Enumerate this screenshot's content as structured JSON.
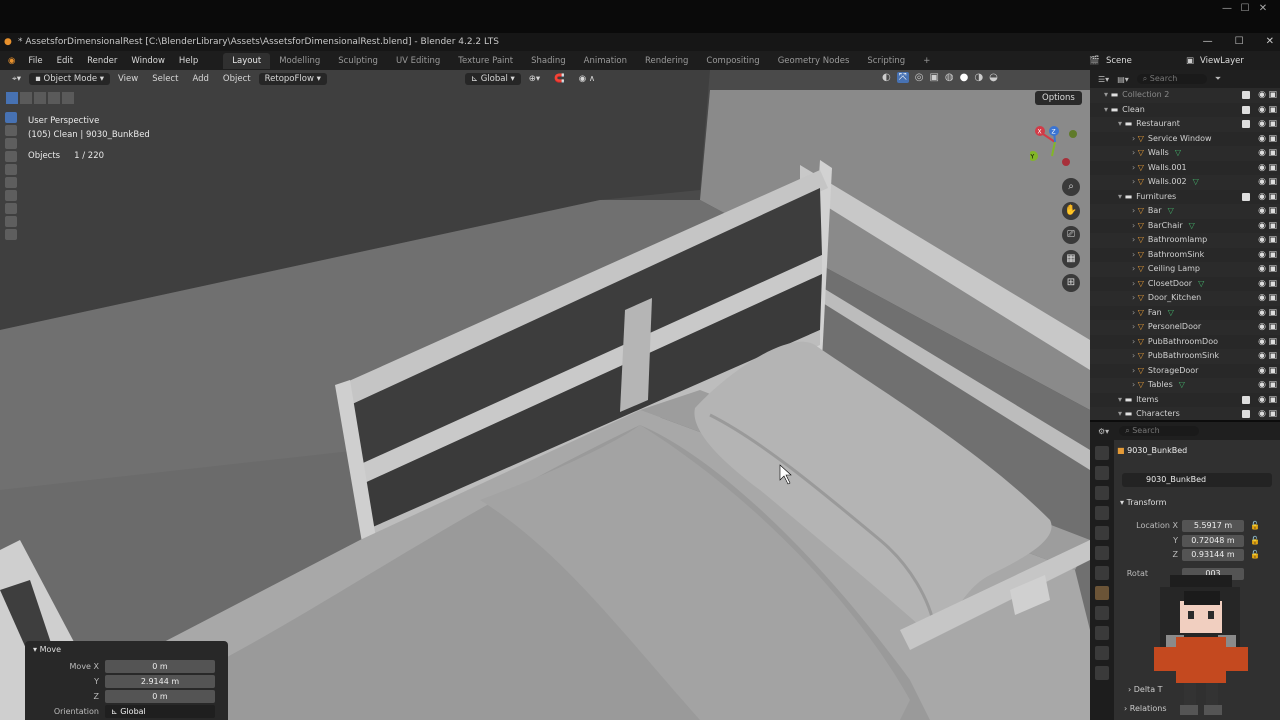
{
  "window": {
    "title": "* AssetsforDimensionalRest [C:\\BlenderLibrary\\Assets\\AssetsforDimensionalRest.blend] - Blender 4.2.2 LTS",
    "controls": [
      "—",
      "☐",
      "✕"
    ]
  },
  "menu": {
    "items": [
      "File",
      "Edit",
      "Render",
      "Window",
      "Help"
    ],
    "tabs": [
      {
        "label": "Layout",
        "active": true
      },
      {
        "label": "Modelling"
      },
      {
        "label": "Sculpting"
      },
      {
        "label": "UV Editing"
      },
      {
        "label": "Texture Paint"
      },
      {
        "label": "Shading"
      },
      {
        "label": "Animation"
      },
      {
        "label": "Rendering"
      },
      {
        "label": "Compositing"
      },
      {
        "label": "Geometry Nodes"
      },
      {
        "label": "Scripting"
      }
    ],
    "add_tab": "+",
    "scene": "Scene",
    "view_layer": "ViewLayer"
  },
  "viewport_header": {
    "mode": "Object Mode",
    "items": [
      "View",
      "Select",
      "Add",
      "Object"
    ],
    "addon": "RetopoFlow",
    "orientation": "Global",
    "options": "Options"
  },
  "viewport_info": {
    "line1": "User Perspective",
    "line2": "(105) Clean | 9030_BunkBed",
    "objects_label": "Objects",
    "objects_value": "1 / 220"
  },
  "gizmo": {
    "x": "X",
    "y": "Y",
    "z": "Z"
  },
  "move_panel": {
    "title": "Move",
    "rows": [
      {
        "label": "Move X",
        "value": "0 m"
      },
      {
        "label": "Y",
        "value": "2.9144 m"
      },
      {
        "label": "Z",
        "value": "0 m"
      },
      {
        "label": "Orientation",
        "value": "Global"
      }
    ]
  },
  "outliner": {
    "search_placeholder": "Search",
    "rows": [
      {
        "label": "Collection 2",
        "indent": 0,
        "kind": "collection",
        "dim": true
      },
      {
        "label": "Clean",
        "indent": 0,
        "kind": "collection"
      },
      {
        "label": "Restaurant",
        "indent": 1,
        "kind": "collection"
      },
      {
        "label": "Service Window",
        "indent": 2,
        "kind": "object"
      },
      {
        "label": "Walls",
        "indent": 2,
        "kind": "object",
        "mesh": true
      },
      {
        "label": "Walls.001",
        "indent": 2,
        "kind": "object"
      },
      {
        "label": "Walls.002",
        "indent": 2,
        "kind": "object",
        "mesh": true
      },
      {
        "label": "Furnitures",
        "indent": 1,
        "kind": "collection"
      },
      {
        "label": "Bar",
        "indent": 2,
        "kind": "object",
        "mesh": true
      },
      {
        "label": "BarChair",
        "indent": 2,
        "kind": "object",
        "mesh": true
      },
      {
        "label": "Bathroomlamp",
        "indent": 2,
        "kind": "object"
      },
      {
        "label": "BathroomSink",
        "indent": 2,
        "kind": "object"
      },
      {
        "label": "Ceiling Lamp",
        "indent": 2,
        "kind": "object"
      },
      {
        "label": "ClosetDoor",
        "indent": 2,
        "kind": "object",
        "mesh": true
      },
      {
        "label": "Door_Kitchen",
        "indent": 2,
        "kind": "object"
      },
      {
        "label": "Fan",
        "indent": 2,
        "kind": "object",
        "mesh": true
      },
      {
        "label": "PersonelDoor",
        "indent": 2,
        "kind": "object"
      },
      {
        "label": "PubBathroomDoo",
        "indent": 2,
        "kind": "object"
      },
      {
        "label": "PubBathroomSink",
        "indent": 2,
        "kind": "object"
      },
      {
        "label": "StorageDoor",
        "indent": 2,
        "kind": "object"
      },
      {
        "label": "Tables",
        "indent": 2,
        "kind": "object",
        "mesh": true
      },
      {
        "label": "Items",
        "indent": 1,
        "kind": "collection"
      },
      {
        "label": "Characters",
        "indent": 1,
        "kind": "collection"
      }
    ]
  },
  "properties": {
    "search_placeholder": "Search",
    "object_name": "9030_BunkBed",
    "data_name": "9030_BunkBed",
    "section": "Transform",
    "rows": [
      {
        "label": "Location X",
        "value": "5.5917 m"
      },
      {
        "label": "Y",
        "value": "0.72048 m"
      },
      {
        "label": "Z",
        "value": "0.93144 m"
      },
      {
        "label": "Rotat",
        "value": "003"
      }
    ],
    "delta": "Delta T",
    "relations": "Relations"
  },
  "colors": {
    "accent": "#4772b3",
    "collection_icon": "#e59b37",
    "mesh_icon": "#44b26b",
    "axis_x": "#d23b47",
    "axis_y": "#82b628",
    "axis_z": "#3a74d3"
  }
}
